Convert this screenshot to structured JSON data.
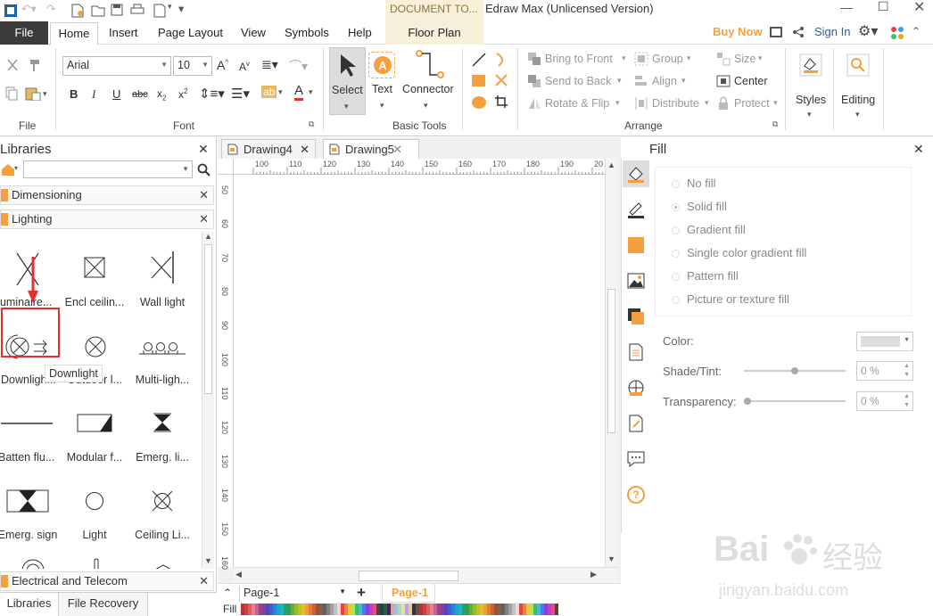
{
  "title_bar": {
    "document_tools": "DOCUMENT TO...",
    "title": "Edraw Max (Unlicensed Version)"
  },
  "menu_tabs": [
    "File",
    "Home",
    "Insert",
    "Page Layout",
    "View",
    "Symbols",
    "Help",
    "Floor Plan"
  ],
  "header_right": {
    "buy_now": "Buy Now",
    "sign_in": "Sign In"
  },
  "ribbon": {
    "font": {
      "family": "Arial",
      "size": "10",
      "group_label": "Font"
    },
    "file_group_label": "File",
    "basic_tools": {
      "select": "Select",
      "text": "Text",
      "connector": "Connector",
      "group_label": "Basic Tools"
    },
    "arrange": {
      "bring_to_front": "Bring to Front",
      "send_to_back": "Send to Back",
      "rotate_flip": "Rotate & Flip",
      "group": "Group",
      "align": "Align",
      "distribute": "Distribute",
      "size": "Size",
      "center": "Center",
      "protect": "Protect",
      "group_label": "Arrange"
    },
    "styles": "Styles",
    "editing": "Editing"
  },
  "libraries": {
    "title": "Libraries",
    "sections": [
      "Dimensioning",
      "Lighting",
      "Electrical and Telecom"
    ],
    "shapes": [
      "Luminaire...",
      "Encl ceilin...",
      "Wall light",
      "Downligh...",
      "Outdoor l...",
      "Multi-ligh...",
      "Batten flu...",
      "Modular f...",
      "Emerg. li...",
      "Emerg. sign",
      "Light",
      "Ceiling Li..."
    ],
    "tooltip": "Downlight",
    "bottom_tabs": [
      "Libraries",
      "File Recovery"
    ]
  },
  "documents": {
    "tabs": [
      "Drawing4",
      "Drawing5"
    ],
    "ruler_top": [
      "100",
      "110",
      "120",
      "130",
      "140",
      "150",
      "160",
      "170",
      "180",
      "190",
      "20"
    ],
    "ruler_left": [
      "50",
      "60",
      "70",
      "80",
      "90",
      "100",
      "110",
      "120",
      "130",
      "140",
      "150",
      "160"
    ],
    "page_selector": "Page-1",
    "page_tab": "Page-1",
    "fill_label": "Fill"
  },
  "fill_panel": {
    "title": "Fill",
    "options": [
      "No fill",
      "Solid fill",
      "Gradient fill",
      "Single color gradient fill",
      "Pattern fill",
      "Picture or texture fill"
    ],
    "selected_option": "Solid fill",
    "color_label": "Color:",
    "shade_label": "Shade/Tint:",
    "shade_value": "0 %",
    "transparency_label": "Transparency:",
    "transparency_value": "0 %"
  },
  "watermark": {
    "brand": "Bai",
    "brand2": "经验",
    "url": "jingyan.baidu.com"
  },
  "colors": {
    "accent": "#f5a040",
    "highlight_box": "#e03030",
    "file_tab": "#3b3b3b"
  }
}
